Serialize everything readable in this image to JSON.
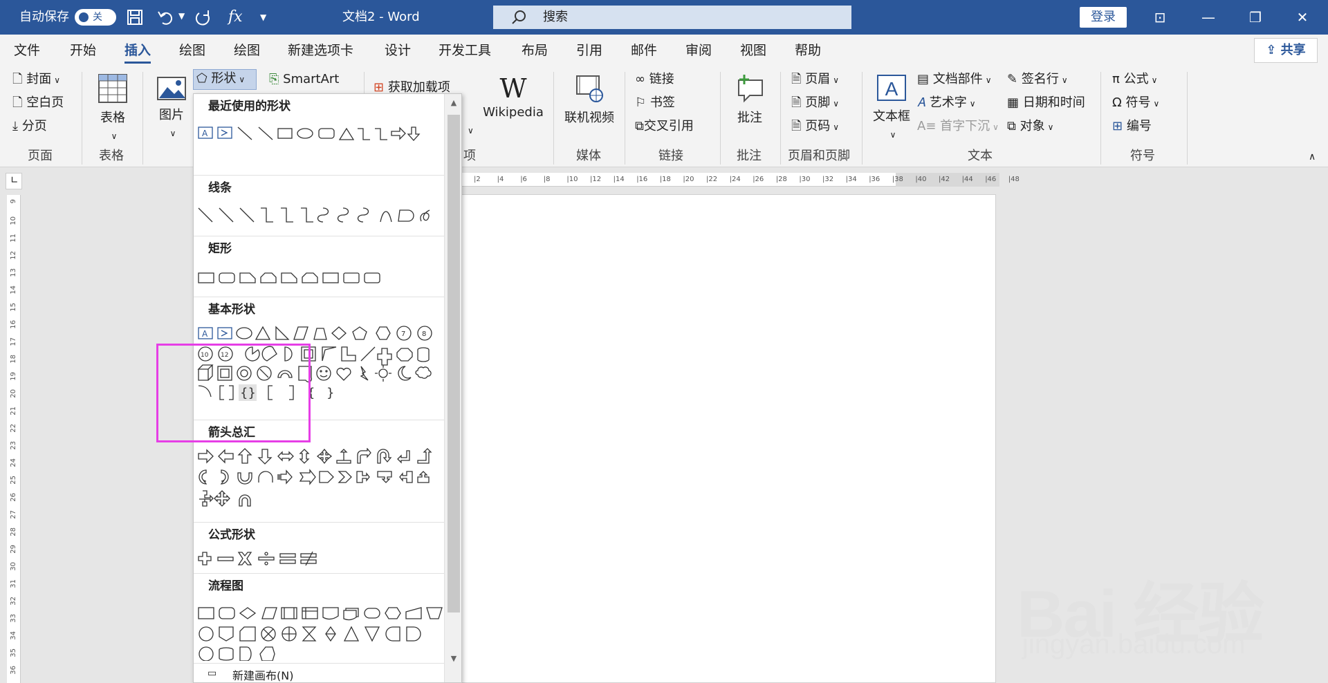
{
  "titlebar": {
    "autosave_label": "自动保存",
    "autosave_state": "关",
    "doc_title": "文档2  -  Word",
    "search_placeholder": "搜索",
    "login_label": "登录"
  },
  "tabs": [
    "文件",
    "开始",
    "插入",
    "绘图",
    "绘图",
    "新建选项卡",
    "设计",
    "开发工具",
    "布局",
    "引用",
    "邮件",
    "审阅",
    "视图",
    "帮助"
  ],
  "share_label": "共享",
  "ribbon": {
    "pages": {
      "cover": "封面",
      "blank": "空白页",
      "break": "分页",
      "group": "页面"
    },
    "tables": {
      "table": "表格",
      "group": "表格"
    },
    "illustrations": {
      "picture": "图片",
      "shapes": "形状",
      "smartart": "SmartArt"
    },
    "addins": {
      "get": "获取加载项",
      "wikipedia": "Wikipedia",
      "group": "项"
    },
    "media": {
      "video": "联机视频",
      "group": "媒体"
    },
    "links": {
      "link": "链接",
      "bookmark": "书签",
      "crossref": "交叉引用",
      "group": "链接"
    },
    "comments": {
      "comment": "批注",
      "group": "批注"
    },
    "headerfooter": {
      "header": "页眉",
      "footer": "页脚",
      "pagenum": "页码",
      "group": "页眉和页脚"
    },
    "text": {
      "textbox": "文本框",
      "parts": "文档部件",
      "wordart": "艺术字",
      "dropcap": "首字下沉",
      "signature": "签名行",
      "datetime": "日期和时间",
      "object": "对象",
      "group": "文本"
    },
    "symbols": {
      "equation": "公式",
      "symbol": "符号",
      "number": "编号",
      "group": "符号"
    }
  },
  "ruler_top": [
    "2",
    "4",
    "6",
    "8",
    "10",
    "12",
    "14",
    "16",
    "18",
    "20",
    "22",
    "24",
    "26",
    "28",
    "30",
    "32",
    "34",
    "36",
    "38",
    "40",
    "42",
    "44",
    "46",
    "48"
  ],
  "ruler_left": [
    "9",
    "10",
    "11",
    "12",
    "13",
    "14",
    "15",
    "16",
    "17",
    "18",
    "19",
    "20",
    "21",
    "22",
    "23",
    "24",
    "25",
    "26",
    "27",
    "28",
    "29",
    "30",
    "31",
    "32",
    "33",
    "34",
    "35",
    "36"
  ],
  "shapes_panel": {
    "recent": "最近使用的形状",
    "lines": "线条",
    "rects": "矩形",
    "basic": "基本形状",
    "arrows": "箭头总汇",
    "equation": "公式形状",
    "flowchart": "流程图",
    "footer": "新建画布(N)"
  },
  "watermark": {
    "brand": "Bai  经验",
    "url": "jingyan.baidu.com"
  }
}
